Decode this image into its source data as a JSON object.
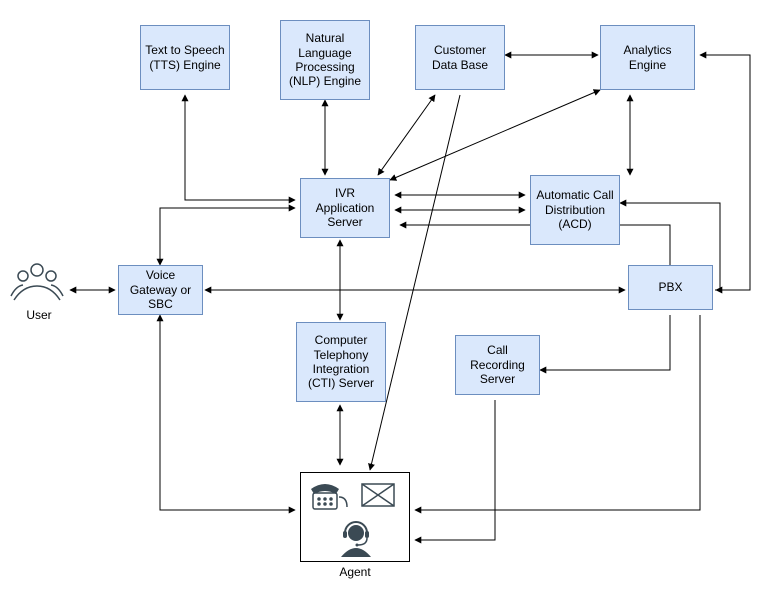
{
  "nodes": {
    "user_label": "User",
    "voice_gateway": "Voice Gateway or SBC",
    "tts": "Text to Speech (TTS) Engine",
    "nlp": "Natural Language Processing (NLP) Engine",
    "cust_db": "Customer Data Base",
    "analytics": "Analytics Engine",
    "ivr": "IVR Application Server",
    "acd": "Automatic Call Distribution (ACD)",
    "pbx": "PBX",
    "cti": "Computer Telephony Integration (CTI) Server",
    "call_rec": "Call Recording Server",
    "agent_label": "Agent"
  }
}
